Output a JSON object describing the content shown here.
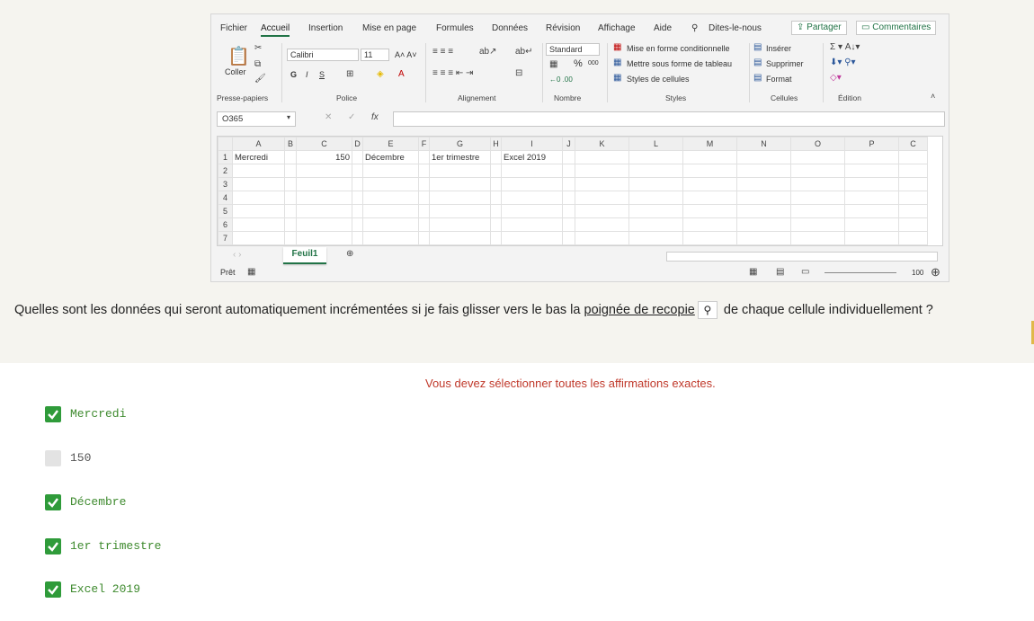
{
  "excel": {
    "tabs": [
      "Fichier",
      "Accueil",
      "Insertion",
      "Mise en page",
      "Formules",
      "Données",
      "Révision",
      "Affichage",
      "Aide"
    ],
    "search": "Dites-le-nous",
    "share": "Partager",
    "comments": "Commentaires",
    "ribbon": {
      "paste": "Coller",
      "font_name": "Calibri",
      "font_size": "11",
      "bold": "G",
      "italic": "I",
      "underline": "S",
      "number_format": "Standard",
      "percent": "%",
      "thousands": "000",
      "cond_format": "Mise en forme conditionnelle",
      "table_format": "Mettre sous forme de tableau",
      "cell_styles": "Styles de cellules",
      "insert": "Insérer",
      "delete": "Supprimer",
      "format": "Format",
      "groups": [
        "Presse-papiers",
        "Police",
        "Alignement",
        "Nombre",
        "Styles",
        "Cellules",
        "Édition"
      ]
    },
    "namebox": "O365",
    "fx": "fx",
    "columns": [
      "A",
      "B",
      "C",
      "D",
      "E",
      "F",
      "G",
      "H",
      "I",
      "J",
      "K",
      "L",
      "M",
      "N",
      "O",
      "P",
      "C"
    ],
    "rows": [
      "1",
      "2",
      "3",
      "4",
      "5",
      "6",
      "7"
    ],
    "row1": {
      "A": "Mercredi",
      "C": "150",
      "E": "Décembre",
      "G": "1er trimestre",
      "I": "Excel 2019"
    },
    "sheet": "Feuil1",
    "status": "Prêt",
    "zoom": "100"
  },
  "question": {
    "before": "Quelles sont les données qui seront automatiquement incrémentées si je fais glisser vers le bas la ",
    "link": "poignée de recopie",
    "after": " de chaque cellule individuellement ?"
  },
  "instruction": "Vous devez sélectionner toutes les affirmations exactes.",
  "options": [
    {
      "label": "Mercredi",
      "checked": true
    },
    {
      "label": "150",
      "checked": false
    },
    {
      "label": "Décembre",
      "checked": true
    },
    {
      "label": "1er trimestre",
      "checked": true
    },
    {
      "label": "Excel 2019",
      "checked": true
    }
  ]
}
